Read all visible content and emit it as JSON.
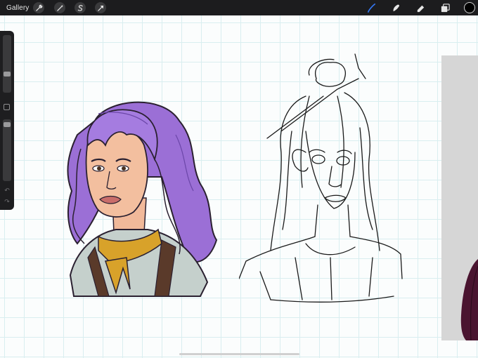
{
  "toolbar": {
    "gallery_label": "Gallery",
    "left_tools": [
      "wrench-icon",
      "magic-wand-icon",
      "selection-icon",
      "transform-arrow-icon"
    ],
    "right_tools": [
      "brush-icon",
      "smudge-icon",
      "eraser-icon",
      "layers-icon"
    ],
    "active_tool": "brush-icon",
    "active_tool_color": "#3478f6",
    "current_color": "#000000"
  },
  "sidebar": {
    "brush_size": 0.55,
    "opacity": 0.95,
    "icons": [
      "modify-square-icon",
      "undo-icon",
      "redo-icon"
    ]
  },
  "canvas": {
    "grid_color": "#d9eef0",
    "artworks": [
      "colored-portrait-purple-hair",
      "pencil-sketch-portrait"
    ]
  }
}
